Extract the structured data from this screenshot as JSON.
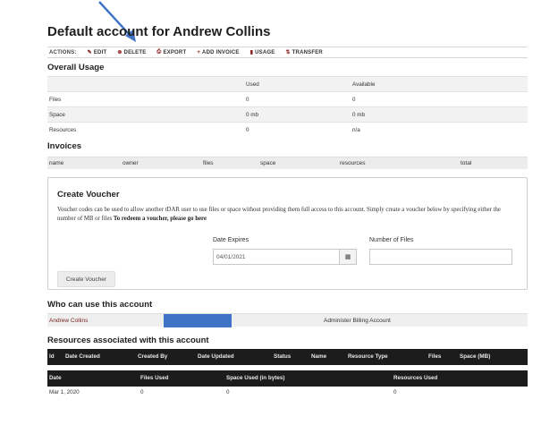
{
  "page": {
    "title": "Default account for Andrew Collins"
  },
  "actions": {
    "label": "ACTIONS:",
    "items": [
      {
        "icon": "pencil-icon",
        "glyph": "✎",
        "label": "EDIT"
      },
      {
        "icon": "delete-icon",
        "glyph": "⊗",
        "label": "DELETE"
      },
      {
        "icon": "export-icon",
        "glyph": "⎙",
        "label": "EXPORT"
      },
      {
        "icon": "plus-icon",
        "glyph": "+",
        "label": "ADD INVOICE"
      },
      {
        "icon": "chart-icon",
        "glyph": "▮",
        "label": "USAGE"
      },
      {
        "icon": "transfer-icon",
        "glyph": "⇅",
        "label": "TRANSFER"
      }
    ]
  },
  "usage": {
    "title": "Overall Usage",
    "columns": [
      "",
      "Used",
      "Available"
    ],
    "rows": [
      {
        "label": "Files",
        "used": "0",
        "available": "0"
      },
      {
        "label": "Space",
        "used": "0 mb",
        "available": "0 mb"
      },
      {
        "label": "Resources",
        "used": "0",
        "available": "n/a"
      }
    ]
  },
  "invoices": {
    "title": "Invoices",
    "columns": [
      "name",
      "owner",
      "files",
      "space",
      "resources",
      "total"
    ]
  },
  "voucher": {
    "title": "Create Voucher",
    "description": "Voucher codes can be used to allow another tDAR user to use files or space without providing them full access to this account. Simply create a voucher below by specifying either the number of MB or files ",
    "redeem_text": "To redeem a voucher, please go here",
    "date_label": "Date Expires",
    "date_value": "04/01/2021",
    "files_label": "Number of Files",
    "files_value": "",
    "button_label": "Create Voucher"
  },
  "access": {
    "title": "Who can use this account",
    "user": "Andrew Collins",
    "role": "Administer Billing Account"
  },
  "resources": {
    "title": "Resources associated with this account",
    "columns": [
      "Id",
      "Date Created",
      "Created By",
      "Date Updated",
      "Status",
      "Name",
      "Resource Type",
      "Files",
      "Space (MB)"
    ]
  },
  "history": {
    "columns": [
      "Date",
      "Files Used",
      "Space Used (in bytes)",
      "Resources Used"
    ],
    "rows": [
      {
        "date": "Mar 1, 2020",
        "files": "0",
        "space": "0",
        "resources": "0"
      }
    ]
  },
  "colors": {
    "accent_blue": "#3e73c6",
    "link_red": "#7a2323",
    "header_dark": "#1c1c1c"
  }
}
